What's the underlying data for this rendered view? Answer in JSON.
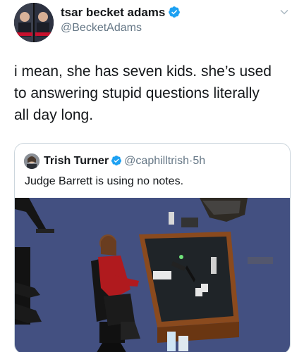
{
  "tweet": {
    "author_name": "tsar becket adams",
    "author_handle": "@BecketAdams",
    "text_lines": [
      "i mean, she has seven kids. she’s used",
      "to answering stupid questions literally",
      "all day long."
    ]
  },
  "quoted_tweet": {
    "author_name": "Trish Turner",
    "author_handle": "@caphilltrish",
    "separator": "·",
    "time": "5h",
    "text": "Judge Barrett is using no notes."
  },
  "icons": {
    "verified": "verified-badge-icon",
    "more": "chevron-down-icon"
  },
  "colors": {
    "verified_blue": "#1da1f2",
    "secondary_text": "#657786",
    "border": "#ccd6dd"
  }
}
